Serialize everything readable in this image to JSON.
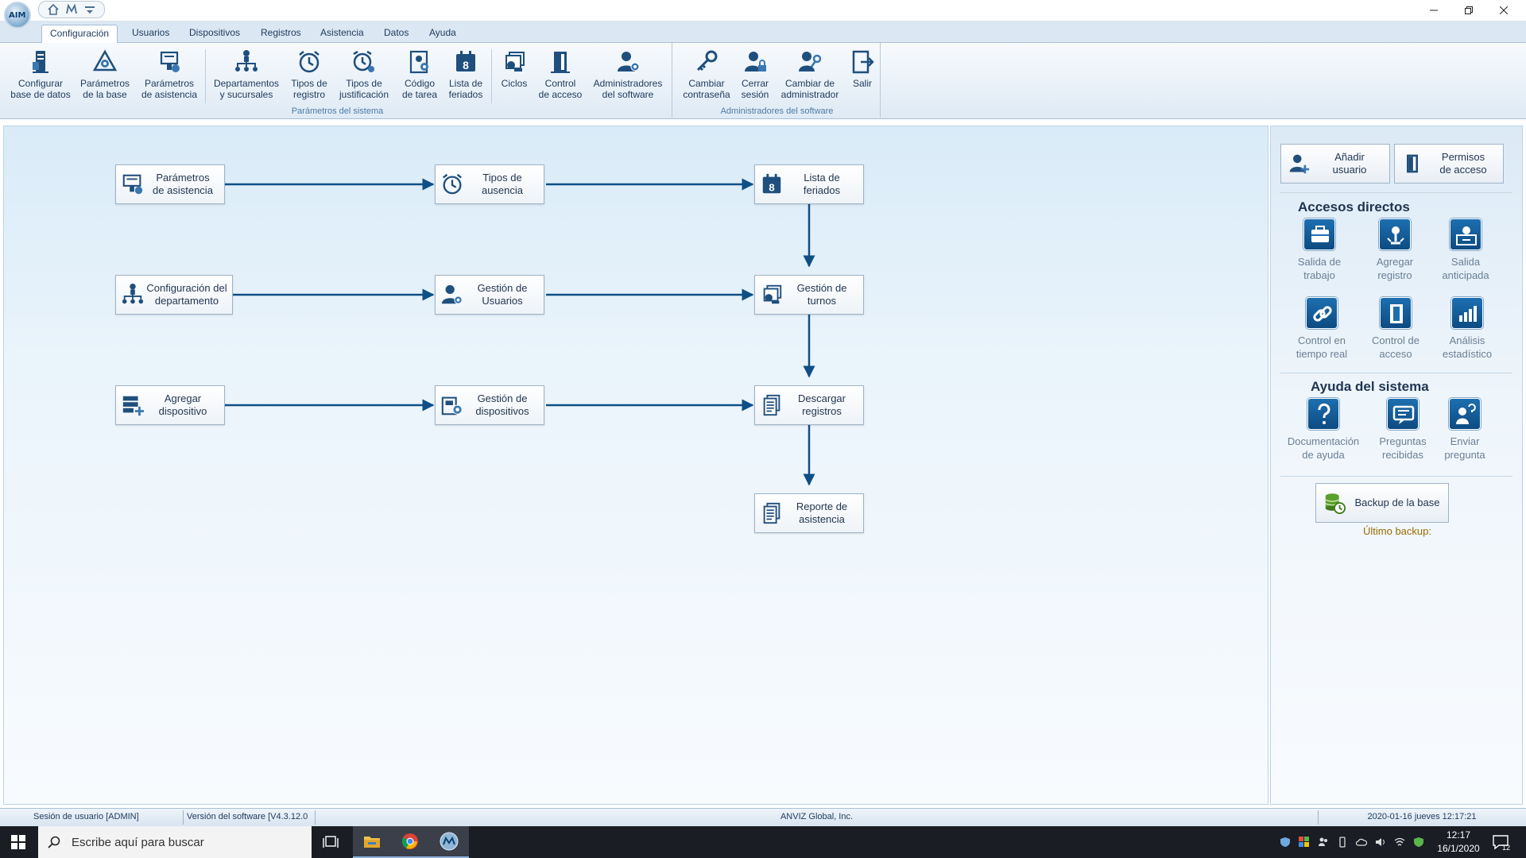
{
  "titlebar": {
    "logo_text": "AIM",
    "window_controls": [
      "minimize-icon",
      "restore-icon",
      "close-icon"
    ]
  },
  "menu_tabs": [
    {
      "label": "Configuración",
      "active": true
    },
    {
      "label": "Usuarios"
    },
    {
      "label": "Dispositivos"
    },
    {
      "label": "Registros"
    },
    {
      "label": "Asistencia"
    },
    {
      "label": "Datos"
    },
    {
      "label": "Ayuda"
    }
  ],
  "ribbon": {
    "groups": [
      {
        "label": "Parámetros del sistema"
      },
      {
        "label": "Administradores del software"
      }
    ],
    "buttons": [
      {
        "line1": "Configurar",
        "line2": "base de datos",
        "icon": "database-server-icon"
      },
      {
        "line1": "Parámetros",
        "line2": "de la base",
        "icon": "database-settings-icon"
      },
      {
        "line1": "Parámetros",
        "line2": "de asistencia",
        "icon": "attendance-settings-icon"
      },
      {
        "line1": "Departamentos",
        "line2": "y sucursales",
        "icon": "org-chart-icon"
      },
      {
        "line1": "Tipos de",
        "line2": "registro",
        "icon": "alarm-clock-icon"
      },
      {
        "line1": "Tipos de",
        "line2": "justificación",
        "icon": "clock-justify-icon"
      },
      {
        "line1": "Código",
        "line2": "de tarea",
        "icon": "task-code-icon"
      },
      {
        "line1": "Lista de",
        "line2": "feriados",
        "icon": "calendar-icon"
      },
      {
        "line1": "Ciclos",
        "line2": "",
        "icon": "shift-cycle-icon"
      },
      {
        "line1": "Control",
        "line2": "de acceso",
        "icon": "door-icon"
      },
      {
        "line1": "Administradores",
        "line2": "del software",
        "icon": "admin-user-icon"
      },
      {
        "line1": "Cambiar",
        "line2": "contraseña",
        "icon": "key-icon"
      },
      {
        "line1": "Cerrar",
        "line2": "sesión",
        "icon": "user-lock-icon"
      },
      {
        "line1": "Cambiar de",
        "line2": "administrador",
        "icon": "switch-admin-icon"
      },
      {
        "line1": "Salir",
        "line2": "",
        "icon": "exit-icon"
      }
    ]
  },
  "flow": {
    "nodes": [
      {
        "id": "att-params",
        "line1": "Parámetros",
        "line2": "de asistencia",
        "icon": "attendance-settings-icon"
      },
      {
        "id": "absence-types",
        "line1": "Tipos de",
        "line2": "ausencia",
        "icon": "alarm-clock-icon"
      },
      {
        "id": "holiday-list",
        "line1": "Lista de",
        "line2": "feriados",
        "icon": "calendar-icon"
      },
      {
        "id": "dept-config",
        "line1": "Configuración del",
        "line2": "departamento",
        "icon": "org-chart-icon"
      },
      {
        "id": "user-mgmt",
        "line1": "Gestión de",
        "line2": "Usuarios",
        "icon": "user-gear-icon"
      },
      {
        "id": "shift-mgmt",
        "line1": "Gestión de",
        "line2": "turnos",
        "icon": "shift-cycle-icon"
      },
      {
        "id": "add-device",
        "line1": "Agregar",
        "line2": "dispositivo",
        "icon": "add-device-icon"
      },
      {
        "id": "device-mgmt",
        "line1": "Gestión de",
        "line2": "dispositivos",
        "icon": "device-gear-icon"
      },
      {
        "id": "download-logs",
        "line1": "Descargar",
        "line2": "registros",
        "icon": "document-stack-icon"
      },
      {
        "id": "att-report",
        "line1": "Reporte de",
        "line2": "asistencia",
        "icon": "report-icon"
      }
    ]
  },
  "right_panel": {
    "top_buttons": [
      {
        "line1": "Añadir",
        "line2": "usuario",
        "icon": "add-user-icon"
      },
      {
        "line1": "Permisos",
        "line2": "de acceso",
        "icon": "door-icon"
      }
    ],
    "shortcuts_title": "Accesos directos",
    "shortcuts": [
      {
        "line1": "Salida de",
        "line2": "trabajo",
        "icon": "briefcase-icon"
      },
      {
        "line1": "Agregar",
        "line2": "registro",
        "icon": "add-record-icon"
      },
      {
        "line1": "Salida",
        "line2": "anticipada",
        "icon": "early-leave-icon"
      },
      {
        "line1": "Control en",
        "line2": "tiempo real",
        "icon": "link-icon"
      },
      {
        "line1": "Control de",
        "line2": "acceso",
        "icon": "door-icon"
      },
      {
        "line1": "Análisis",
        "line2": "estadístico",
        "icon": "bar-chart-icon"
      }
    ],
    "help_title": "Ayuda del sistema",
    "help": [
      {
        "line1": "Documentación",
        "line2": "de ayuda",
        "icon": "question-icon"
      },
      {
        "line1": "Preguntas",
        "line2": "recibidas",
        "icon": "chat-icon"
      },
      {
        "line1": "Enviar",
        "line2": "pregunta",
        "icon": "send-question-icon"
      }
    ],
    "backup_label": "Backup de la base",
    "last_backup": "Último backup:"
  },
  "status_bar": {
    "session": "Sesión de usuario  [ADMIN]",
    "version": "Versión del software  [V4.3.12.0",
    "company": "ANVIZ Global, Inc.",
    "datetime": "2020-01-16 jueves 12:17:21"
  },
  "taskbar": {
    "search_placeholder": "Escribe aquí para buscar",
    "time": "12:17",
    "date": "16/1/2020",
    "notifications": "12"
  },
  "colors": {
    "accent": "#0d4b82",
    "arrow": "#0e4f86",
    "tab_bar": "#dbe7f3",
    "taskbar": "#1a1d24"
  }
}
